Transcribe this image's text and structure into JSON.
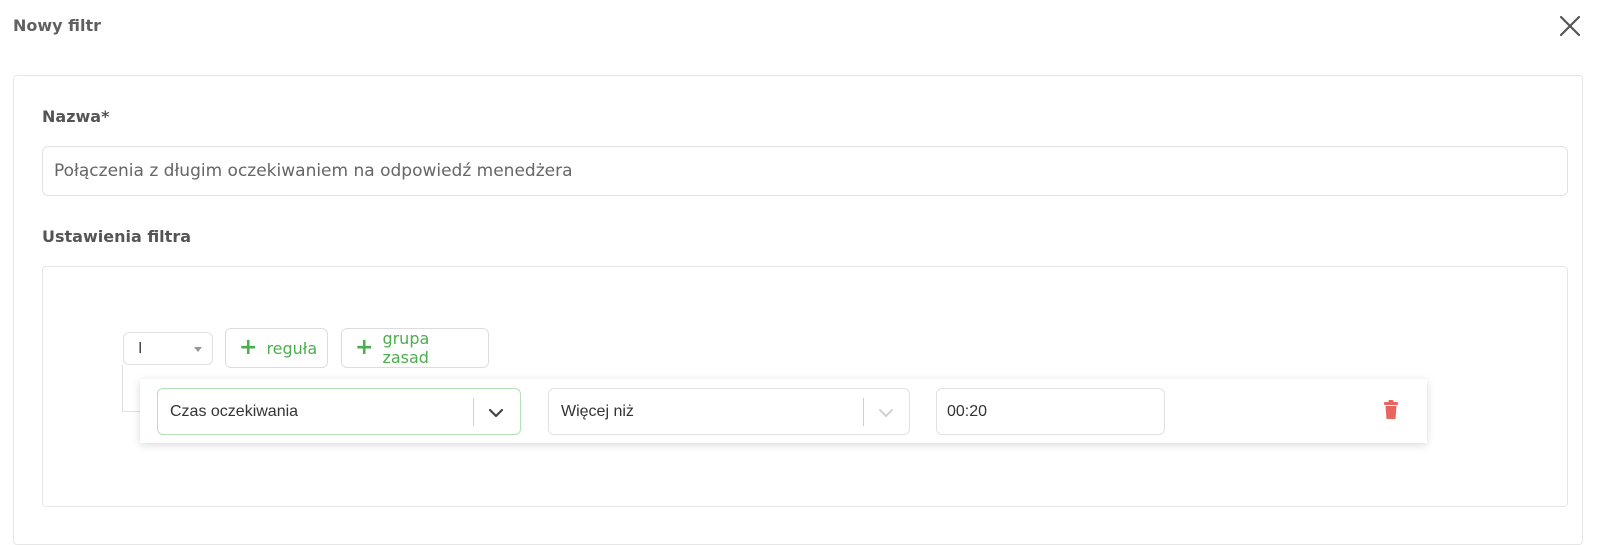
{
  "dialog": {
    "title": "Nowy filtr",
    "close_icon": "close-icon"
  },
  "form": {
    "name_label": "Nazwa*",
    "name_value": "Połączenia z długim oczekiwaniem na odpowiedź menedżera",
    "settings_label": "Ustawienia filtra"
  },
  "builder": {
    "condition": "I",
    "add_rule_label": "reguła",
    "add_group_label": "grupa zasad",
    "rule": {
      "field": "Czas oczekiwania",
      "operator": "Więcej niż",
      "value": "00:20",
      "delete_icon": "trash-icon"
    }
  },
  "colors": {
    "accent_green": "#4cae4c",
    "delete_red": "#e8665f"
  }
}
